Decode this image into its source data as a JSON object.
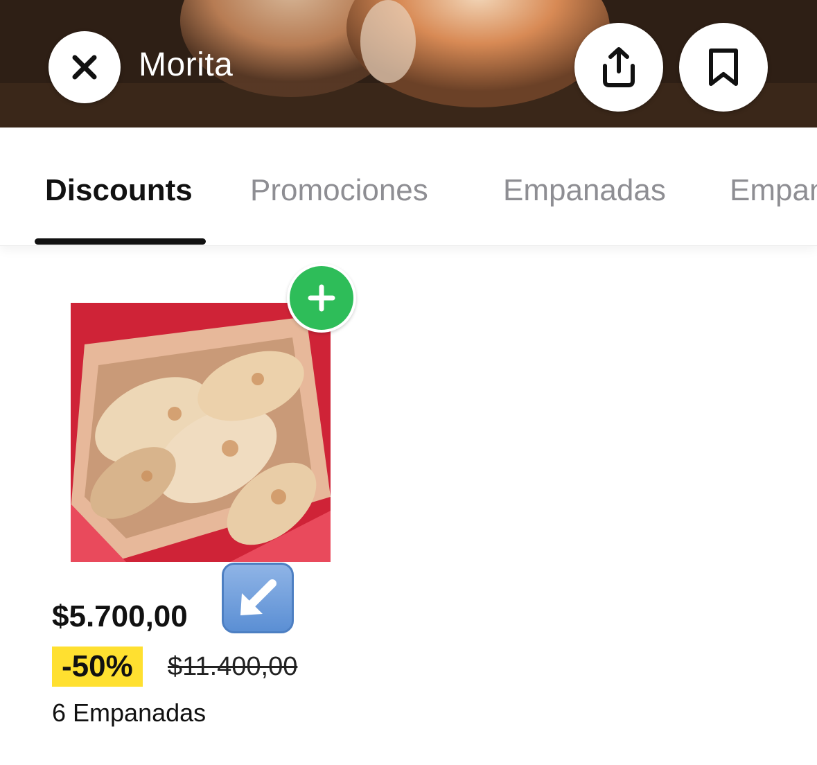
{
  "header": {
    "store_name": "Morita",
    "close_icon": "close-icon",
    "share_icon": "share-icon",
    "bookmark_icon": "bookmark-icon"
  },
  "tabs": [
    {
      "label": "Discounts",
      "active": true
    },
    {
      "label": "Promociones",
      "active": false
    },
    {
      "label": "Empanadas",
      "active": false
    },
    {
      "label": "Empanadas",
      "active": false
    }
  ],
  "product": {
    "price": "$5.700,00",
    "discount": "-50%",
    "original_price": "$11.400,00",
    "name": "6 Empanadas",
    "add_icon": "plus-icon",
    "arrow_icon": "arrow-down-left-icon"
  },
  "colors": {
    "add_button": "#2ebd59",
    "discount_badge": "#ffe030",
    "tab_active": "#111111",
    "tab_inactive": "#8e8e93"
  }
}
